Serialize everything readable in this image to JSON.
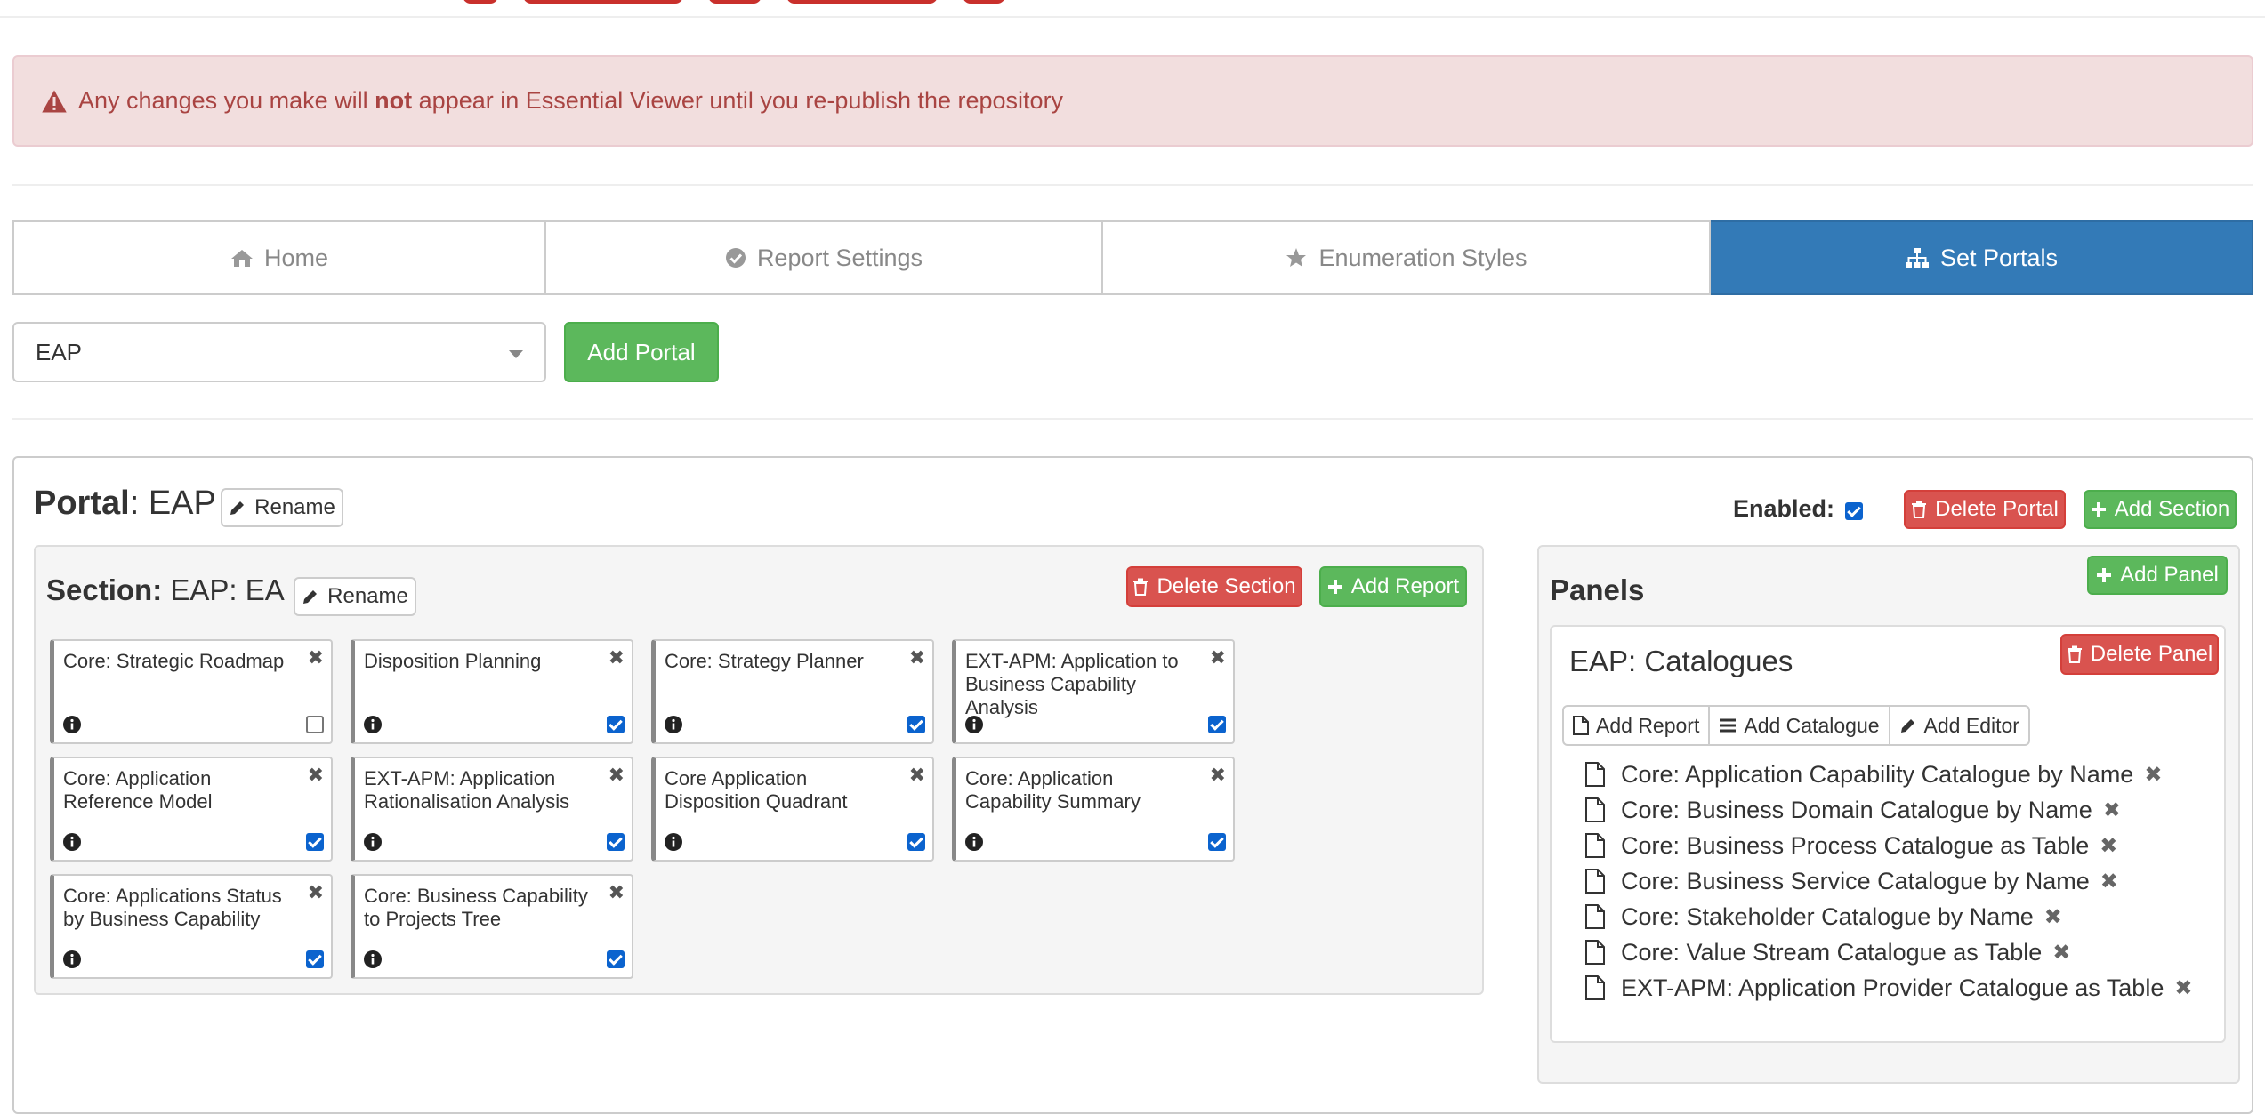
{
  "alert": {
    "prefix": "Any changes you make will ",
    "bold": "not",
    "suffix": " appear in Essential Viewer until you re-publish the repository"
  },
  "tabs": [
    {
      "label": "Home",
      "icon": "home-icon",
      "active": false
    },
    {
      "label": "Report Settings",
      "icon": "check-circle-icon",
      "active": false
    },
    {
      "label": "Enumeration Styles",
      "icon": "star-icon",
      "active": false
    },
    {
      "label": "Set Portals",
      "icon": "sitemap-icon",
      "active": true
    }
  ],
  "portal_select": {
    "value": "EAP"
  },
  "add_portal_label": "Add Portal",
  "portal": {
    "label": "Portal",
    "name": ": EAP",
    "rename_label": "Rename",
    "enabled_label": "Enabled:",
    "enabled": true,
    "delete_label": "Delete Portal",
    "add_section_label": "Add Section"
  },
  "section": {
    "label": "Section:",
    "name": " EAP: EA",
    "rename_label": "Rename",
    "delete_label": "Delete Section",
    "add_report_label": "Add Report",
    "reports": [
      {
        "title": "Core: Strategic Roadmap",
        "checked": false
      },
      {
        "title": "Disposition Planning",
        "checked": true
      },
      {
        "title": "Core: Strategy Planner",
        "checked": true
      },
      {
        "title": "EXT-APM: Application to Business Capability Analysis",
        "checked": true
      },
      {
        "title": "Core: Application Reference Model",
        "checked": true
      },
      {
        "title": "EXT-APM: Application Rationalisation Analysis",
        "checked": true
      },
      {
        "title": "Core Application Disposition Quadrant",
        "checked": true
      },
      {
        "title": "Core: Application Capability Summary",
        "checked": true
      },
      {
        "title": "Core: Applications Status by Business Capability",
        "checked": true
      },
      {
        "title": "Core: Business Capability to Projects Tree",
        "checked": true
      }
    ]
  },
  "panels": {
    "title": "Panels",
    "add_panel_label": "Add Panel",
    "panel": {
      "title": "EAP: Catalogues",
      "delete_label": "Delete Panel",
      "add_report_label": "Add Report",
      "add_catalogue_label": "Add Catalogue",
      "add_editor_label": "Add Editor",
      "items": [
        "Core: Application Capability Catalogue by Name",
        "Core: Business Domain Catalogue by Name",
        "Core: Business Process Catalogue as Table",
        "Core: Business Service Catalogue by Name",
        "Core: Stakeholder Catalogue by Name",
        "Core: Value Stream Catalogue as Table",
        "EXT-APM: Application Provider Catalogue as Table"
      ]
    }
  },
  "colors": {
    "primary": "#337ab7",
    "success": "#5cb85c",
    "danger": "#d9534f",
    "alert_bg": "#f2dede",
    "alert_text": "#a94442"
  }
}
